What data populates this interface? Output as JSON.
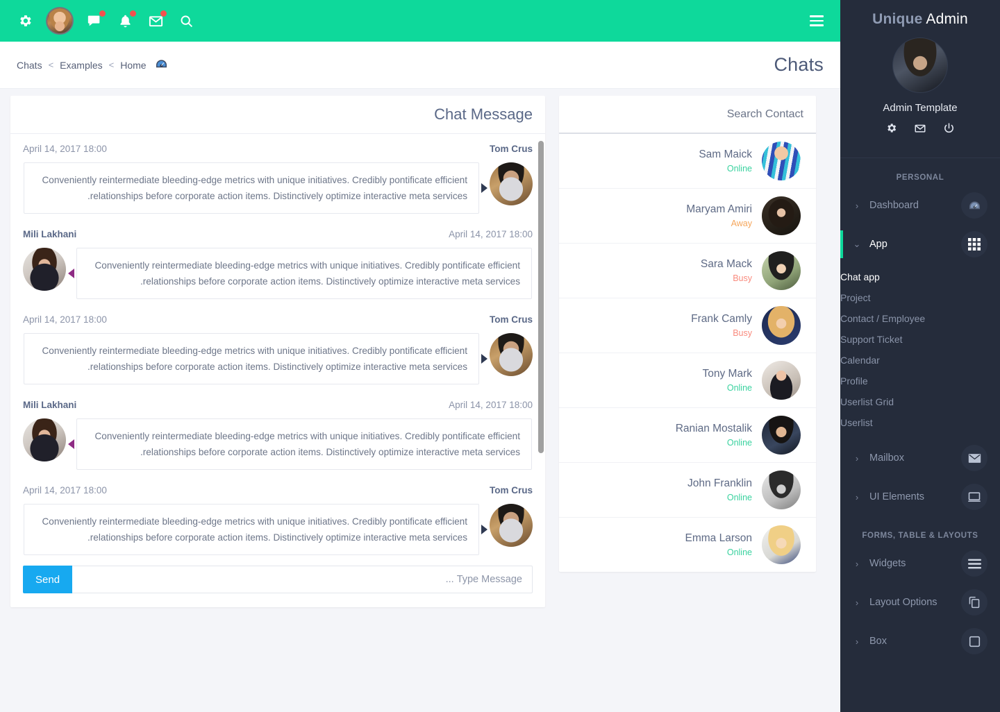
{
  "topbar": {
    "icons": [
      "gear-icon",
      "user-avatar",
      "chat-icon",
      "bell-icon",
      "envelope-icon",
      "search-icon"
    ],
    "menu_toggle": "hamburger-icon",
    "background": "#0ed99b"
  },
  "breadcrumb": {
    "items": [
      {
        "label": "Chats"
      },
      {
        "label": "Examples"
      },
      {
        "label": "Home"
      }
    ],
    "separator": "<",
    "trailing_icon": "dashboard-icon"
  },
  "page": {
    "title": "Chats"
  },
  "chat": {
    "card_title": "Chat Message",
    "messages": [
      {
        "side": "right",
        "name": "Tom Crus",
        "time": "April 14, 2017 18:00",
        "text": "Conveniently reintermediate bleeding-edge metrics with unique initiatives. Credibly pontificate efficient relationships before corporate action items. Distinctively optimize interactive meta services.",
        "avatar": "av-tom"
      },
      {
        "side": "left",
        "name": "Mili Lakhani",
        "time": "April 14, 2017 18:00",
        "text": "Conveniently reintermediate bleeding-edge metrics with unique initiatives. Credibly pontificate efficient relationships before corporate action items. Distinctively optimize interactive meta services.",
        "avatar": "av-mili"
      },
      {
        "side": "right",
        "name": "Tom Crus",
        "time": "April 14, 2017 18:00",
        "text": "Conveniently reintermediate bleeding-edge metrics with unique initiatives. Credibly pontificate efficient relationships before corporate action items. Distinctively optimize interactive meta services.",
        "avatar": "av-tom"
      },
      {
        "side": "left",
        "name": "Mili Lakhani",
        "time": "April 14, 2017 18:00",
        "text": "Conveniently reintermediate bleeding-edge metrics with unique initiatives. Credibly pontificate efficient relationships before corporate action items. Distinctively optimize interactive meta services.",
        "avatar": "av-mili"
      },
      {
        "side": "right",
        "name": "Tom Crus",
        "time": "April 14, 2017 18:00",
        "text": "Conveniently reintermediate bleeding-edge metrics with unique initiatives. Credibly pontificate efficient relationships before corporate action items. Distinctively optimize interactive meta services.",
        "avatar": "av-tom"
      }
    ],
    "composer": {
      "send_label": "Send",
      "placeholder": "Type Message ...",
      "value": "",
      "send_color": "#17a9f0"
    }
  },
  "contacts": {
    "search_placeholder": "Search Contact",
    "search_value": "",
    "status_colors": {
      "Online": "#3ad29f",
      "Away": "#f5a65b",
      "Busy": "#f98b7e"
    },
    "items": [
      {
        "name": "Sam Maick",
        "status": "Online",
        "avatar": "cav-1"
      },
      {
        "name": "Maryam Amiri",
        "status": "Away",
        "avatar": "cav-2"
      },
      {
        "name": "Sara Mack",
        "status": "Busy",
        "avatar": "cav-3"
      },
      {
        "name": "Frank Camly",
        "status": "Busy",
        "avatar": "cav-4"
      },
      {
        "name": "Tony Mark",
        "status": "Online",
        "avatar": "cav-5"
      },
      {
        "name": "Ranian Mostalik",
        "status": "Online",
        "avatar": "cav-6"
      },
      {
        "name": "John Franklin",
        "status": "Online",
        "avatar": "cav-7"
      },
      {
        "name": "Emma Larson",
        "status": "Online",
        "avatar": "cav-8"
      }
    ]
  },
  "sidebar": {
    "brand_bold": "Unique",
    "brand_rest": " Admin",
    "profile_name": "Admin Template",
    "profile_icons": [
      "power-icon",
      "envelope-icon",
      "gear-icon"
    ],
    "sections": [
      {
        "title": "PERSONAL",
        "items": [
          {
            "label": "Dashboard",
            "icon": "dashboard-icon",
            "caret": "‹",
            "active": false
          },
          {
            "label": "App",
            "icon": "grid-icon",
            "caret": "⌄",
            "active": true,
            "children": [
              {
                "label": "Chat app",
                "active": true
              },
              {
                "label": "Project",
                "active": false
              },
              {
                "label": "Contact / Employee",
                "active": false
              },
              {
                "label": "Support Ticket",
                "active": false
              },
              {
                "label": "Calendar",
                "active": false
              },
              {
                "label": "Profile",
                "active": false
              },
              {
                "label": "Userlist Grid",
                "active": false
              },
              {
                "label": "Userlist",
                "active": false
              }
            ]
          },
          {
            "label": "Mailbox",
            "icon": "envelope-icon",
            "caret": "‹",
            "active": false
          },
          {
            "label": "UI Elements",
            "icon": "monitor-icon",
            "caret": "‹",
            "active": false
          }
        ]
      },
      {
        "title": "FORMS, TABLE & LAYOUTS",
        "items": [
          {
            "label": "Widgets",
            "icon": "bars-icon",
            "caret": "‹",
            "active": false
          },
          {
            "label": "Layout Options",
            "icon": "copy-icon",
            "caret": "‹",
            "active": false
          },
          {
            "label": "Box",
            "icon": "square-icon",
            "caret": "‹",
            "active": false
          }
        ]
      }
    ],
    "accent": "#0ed99b",
    "background": "#252c3b"
  }
}
